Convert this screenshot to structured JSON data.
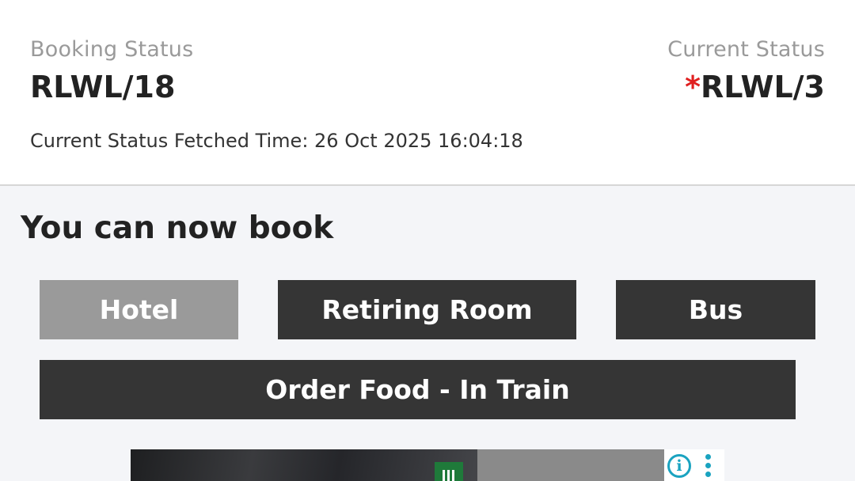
{
  "status": {
    "booking_label": "Booking Status",
    "booking_value": "RLWL/18",
    "current_label": "Current Status",
    "current_marker": "*",
    "current_value": "RLWL/3",
    "fetched_time": "Current Status Fetched Time: 26 Oct 2025 16:04:18"
  },
  "book_section": {
    "title": "You can now book",
    "buttons": {
      "hotel": "Hotel",
      "retiring_room": "Retiring Room",
      "bus": "Bus",
      "order_food": "Order Food - In Train"
    }
  },
  "ad": {
    "info_icon": "info-icon",
    "more_icon": "more-vertical-icon",
    "info_glyph": "i"
  },
  "colors": {
    "accent_red": "#e02020",
    "button_dark": "#353535",
    "button_disabled": "#9a9a9a",
    "ad_icon": "#1aa3c0"
  }
}
